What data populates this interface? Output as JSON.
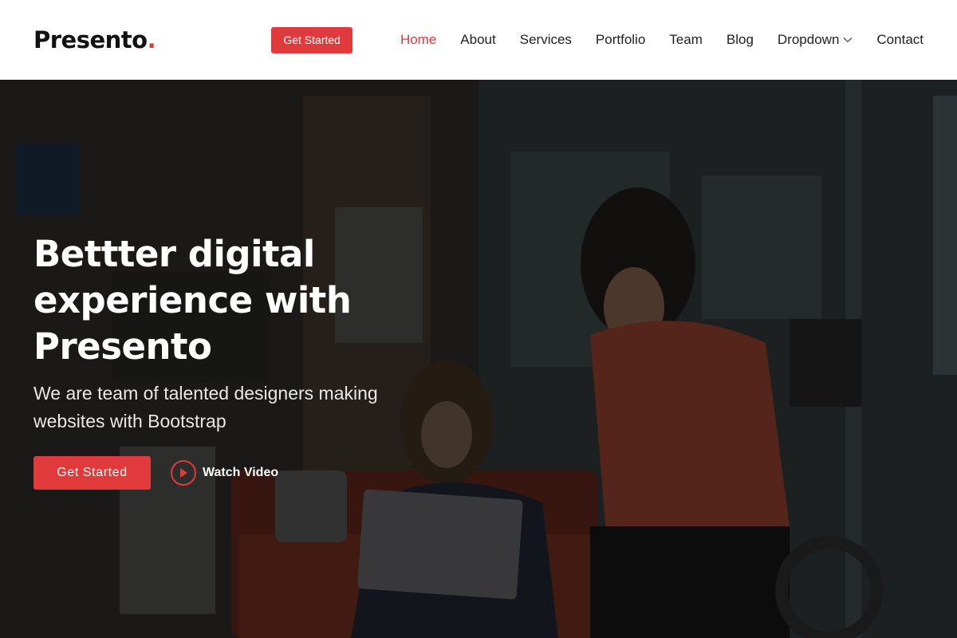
{
  "brand": {
    "name": "Presento",
    "dot": ".",
    "accent": "#e03a3c"
  },
  "header": {
    "cta_label": "Get Started",
    "nav": [
      {
        "label": "Home",
        "active": true
      },
      {
        "label": "About"
      },
      {
        "label": "Services"
      },
      {
        "label": "Portfolio"
      },
      {
        "label": "Team"
      },
      {
        "label": "Blog"
      },
      {
        "label": "Dropdown",
        "icon": "chevron-down-icon"
      },
      {
        "label": "Contact"
      }
    ]
  },
  "hero": {
    "title_lines": [
      "Bettter digital",
      "experience with",
      "Presento"
    ],
    "subtitle": "We are team of talented designers making websites with Bootstrap",
    "primary_button": "Get Started",
    "video_button": "Watch Video",
    "video_icon": "play-icon"
  }
}
